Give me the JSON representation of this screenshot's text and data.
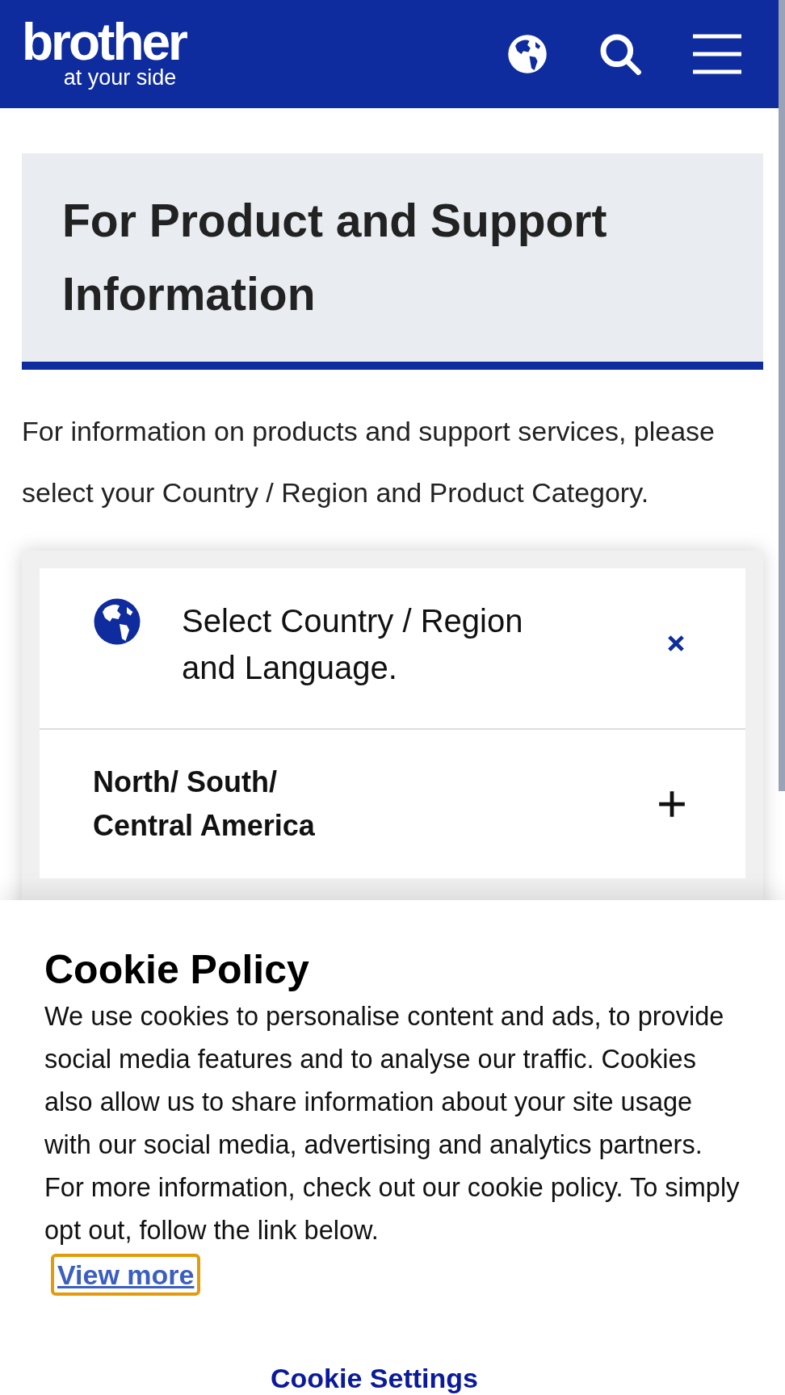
{
  "header": {
    "logo": "brother",
    "tagline": "at your side"
  },
  "hero": {
    "title": "For Product and Support Information"
  },
  "intro": "For information on products and support services, please select your Country / Region and Product Category.",
  "region_selector": {
    "header": {
      "label": "Select Country / Region and Language.",
      "expanded": true
    },
    "regions": [
      {
        "label": "North/ South/ Central America",
        "expanded": false
      }
    ]
  },
  "cookie_banner": {
    "title": "Cookie Policy",
    "body": "We use cookies to personalise content and ads, to provide social media features and to analyse our traffic. Cookies also allow us to share information about your site usage with our social media, advertising and analytics partners. For more information, check out our cookie policy. To simply opt out, follow the link below.",
    "link": "View more",
    "link_focused": true,
    "settings_button": "Cookie Settings"
  }
}
